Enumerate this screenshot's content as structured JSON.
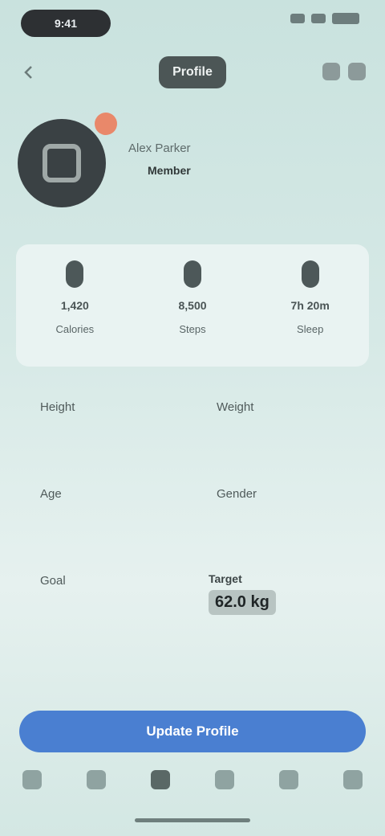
{
  "status": {
    "time": "9:41",
    "right_icons": [
      "signal-icon",
      "wifi-icon",
      "battery-icon"
    ]
  },
  "header": {
    "title": "Profile",
    "left_icon": "back-icon",
    "right_icons": [
      "edit-icon",
      "more-icon"
    ]
  },
  "profile": {
    "name": "Alex Parker",
    "sub": "Member"
  },
  "stats": [
    {
      "icon": "calories-icon",
      "value": "1,420",
      "label": "Calories"
    },
    {
      "icon": "steps-icon",
      "value": "8,500",
      "label": "Steps"
    },
    {
      "icon": "sleep-icon",
      "value": "7h 20m",
      "label": "Sleep"
    }
  ],
  "grid": {
    "items": [
      {
        "label": "Height",
        "sub": ""
      },
      {
        "label": "Weight",
        "sub": ""
      },
      {
        "label": "Age",
        "sub": ""
      },
      {
        "label": "Gender",
        "sub": ""
      },
      {
        "label": "Goal",
        "sub": ""
      }
    ],
    "highlight": {
      "line1": "Target",
      "line2": "62.0 kg"
    }
  },
  "cta": {
    "label": "Update Profile"
  },
  "tabs": [
    {
      "icon": "home-icon",
      "active": false
    },
    {
      "icon": "stats-icon",
      "active": false
    },
    {
      "icon": "plus-icon",
      "active": true
    },
    {
      "icon": "chat-icon",
      "active": false
    },
    {
      "icon": "settings-icon",
      "active": false
    },
    {
      "icon": "user-icon",
      "active": false
    }
  ],
  "colors": {
    "accent": "#4a7fd1",
    "badge": "#e9886a",
    "background": "#d6e9e6"
  }
}
